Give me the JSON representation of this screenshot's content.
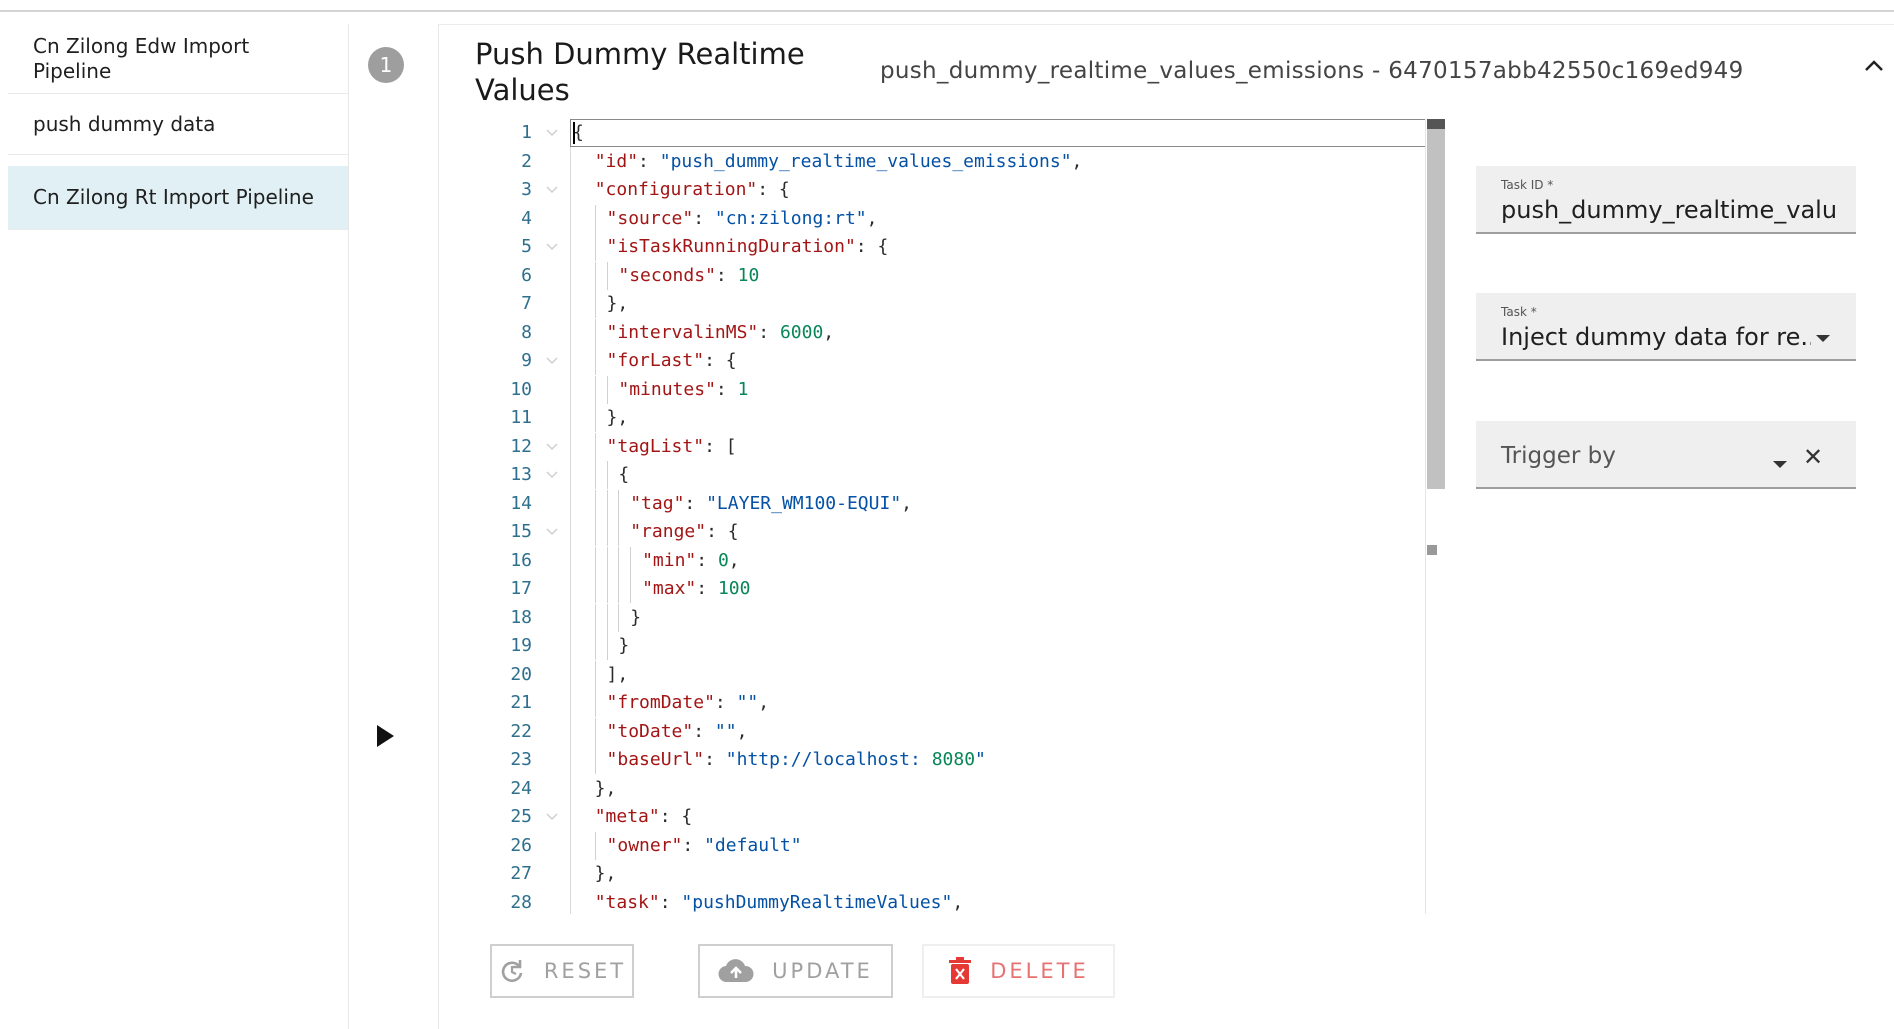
{
  "sidebar": {
    "items": [
      {
        "label": "Cn Zilong Edw Import Pipeline"
      },
      {
        "label": "push dummy data"
      },
      {
        "label": "Cn Zilong Rt Import Pipeline"
      }
    ]
  },
  "step": {
    "number": "1"
  },
  "header": {
    "title": "Push Dummy Realtime Values",
    "subtitle": "push_dummy_realtime_values_emissions - 6470157abb42550c169ed949"
  },
  "editor": {
    "lines": [
      {
        "n": "1",
        "t": "{"
      },
      {
        "n": "2",
        "t": "  \"id\": \"push_dummy_realtime_values_emissions\","
      },
      {
        "n": "3",
        "t": "  \"configuration\": {"
      },
      {
        "n": "4",
        "t": "    \"source\": \"cn:zilong:rt\","
      },
      {
        "n": "5",
        "t": "    \"isTaskRunningDuration\": {"
      },
      {
        "n": "6",
        "t": "      \"seconds\": 10"
      },
      {
        "n": "7",
        "t": "    },"
      },
      {
        "n": "8",
        "t": "    \"intervalinMS\": 6000,"
      },
      {
        "n": "9",
        "t": "    \"forLast\": {"
      },
      {
        "n": "10",
        "t": "      \"minutes\": 1"
      },
      {
        "n": "11",
        "t": "    },"
      },
      {
        "n": "12",
        "t": "    \"tagList\": ["
      },
      {
        "n": "13",
        "t": "      {"
      },
      {
        "n": "14",
        "t": "        \"tag\": \"LAYER_WM100-EQUI\","
      },
      {
        "n": "15",
        "t": "        \"range\": {"
      },
      {
        "n": "16",
        "t": "          \"min\": 0,"
      },
      {
        "n": "17",
        "t": "          \"max\": 100"
      },
      {
        "n": "18",
        "t": "        }"
      },
      {
        "n": "19",
        "t": "      }"
      },
      {
        "n": "20",
        "t": "    ],"
      },
      {
        "n": "21",
        "t": "    \"fromDate\": \"\","
      },
      {
        "n": "22",
        "t": "    \"toDate\": \"\","
      },
      {
        "n": "23",
        "t": "    \"baseUrl\": \"http://localhost:8080\""
      },
      {
        "n": "24",
        "t": "  },"
      },
      {
        "n": "25",
        "t": "  \"meta\": {"
      },
      {
        "n": "26",
        "t": "    \"owner\": \"default\""
      },
      {
        "n": "27",
        "t": "  },"
      },
      {
        "n": "28",
        "t": "  \"task\": \"pushDummyRealtimeValues\","
      }
    ],
    "folds": [
      "1",
      "3",
      "5",
      "9",
      "12",
      "13",
      "15",
      "25"
    ]
  },
  "fields": {
    "task_id": {
      "label": "Task ID *",
      "value": "push_dummy_realtime_valu"
    },
    "task": {
      "label": "Task *",
      "value": "Inject dummy data for re..."
    },
    "trigger": {
      "placeholder": "Trigger by"
    }
  },
  "buttons": {
    "reset": "RESET",
    "update": "UPDATE",
    "delete": "DELETE"
  },
  "colors": {
    "active_sidebar": "#e0f0f4",
    "json_key": "#a31515",
    "json_string": "#0451a5",
    "json_number": "#098658",
    "delete": "#e57373"
  }
}
